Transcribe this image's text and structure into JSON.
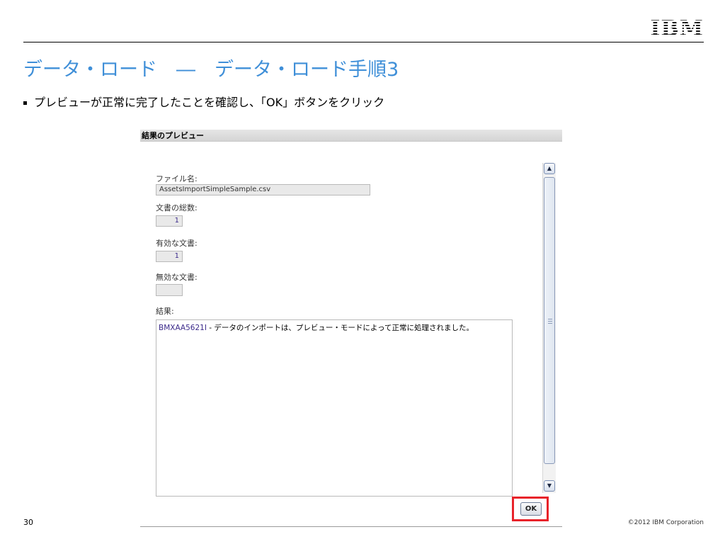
{
  "slide": {
    "logo": "IBM",
    "title": "データ・ロード　―　データ・ロード手順3",
    "bullet": "プレビューが正常に完了したことを確認し、「OK」ボタンをクリック",
    "page_number": "30",
    "copyright": "©2012 IBM Corporation"
  },
  "dialog": {
    "header": "結果のプレビュー",
    "fields": {
      "file_name_label": "ファイル名:",
      "file_name_value": "AssetsImportSimpleSample.csv",
      "total_docs_label": "文書の総数:",
      "total_docs_value": "1",
      "valid_docs_label": "有効な文書:",
      "valid_docs_value": "1",
      "invalid_docs_label": "無効な文書:",
      "invalid_docs_value": "",
      "result_label": "結果:",
      "result_code": "BMXAA5621I",
      "result_text": " - データのインポートは、プレビュー・モードによって正常に処理されました。"
    },
    "ok_label": "OK"
  },
  "colors": {
    "title": "#3f8fd8",
    "highlight": "#e8232a"
  },
  "icons": {
    "scroll_up": "chevron-up-icon",
    "scroll_down": "chevron-down-icon"
  }
}
